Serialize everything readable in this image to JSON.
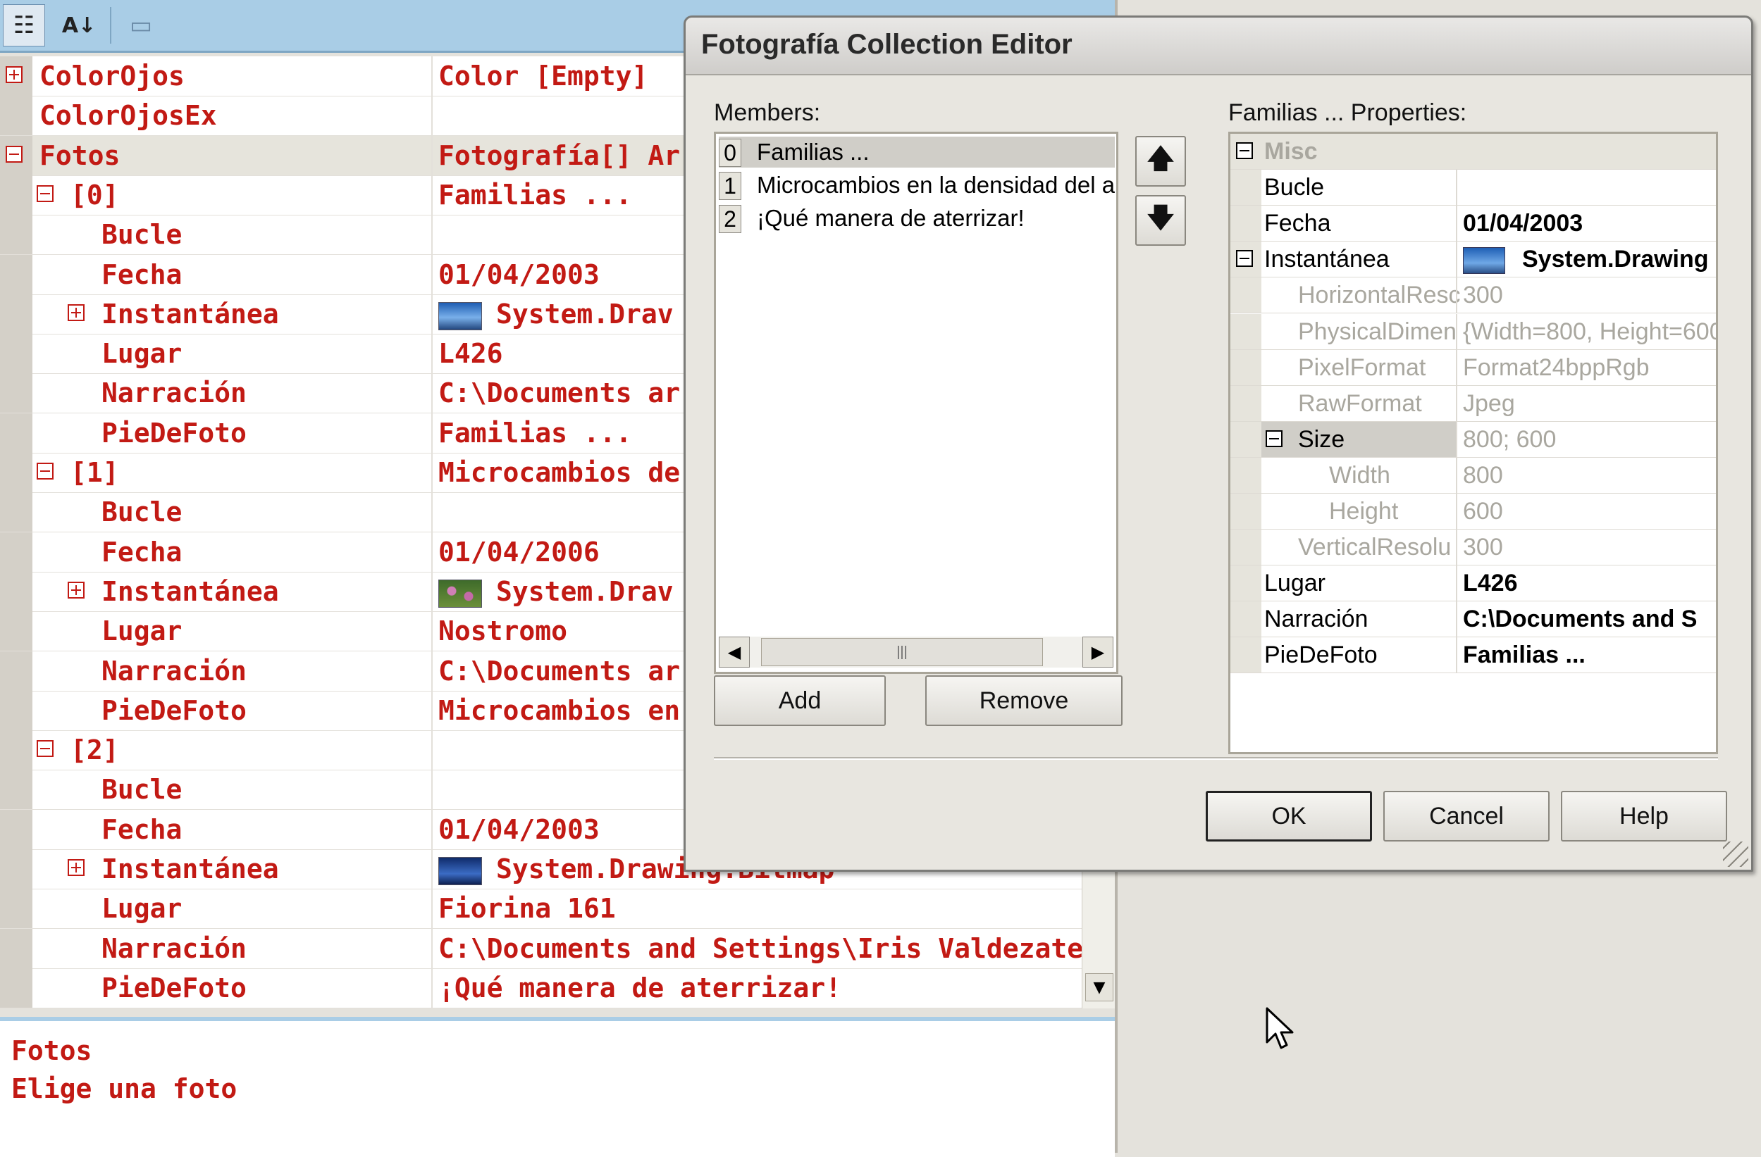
{
  "property_grid": {
    "toolbar": {
      "categorized_glyph": "☷",
      "alphabetical_glyph": "A↓",
      "property_pages_glyph": "▭"
    },
    "rows": [
      {
        "name": "ColorOjos",
        "value": "Color [Empty]",
        "level": 0,
        "toggle": "plus"
      },
      {
        "name": "ColorOjosEx",
        "value": "",
        "level": 0,
        "toggle": ""
      },
      {
        "name": "Fotos",
        "value": "Fotografía[] Arra",
        "level": 0,
        "toggle": "minus",
        "selected": true
      },
      {
        "name": "[0]",
        "value": "Familias ...",
        "level": 1,
        "toggle": "minus"
      },
      {
        "name": "Bucle",
        "value": "",
        "level": 2,
        "toggle": ""
      },
      {
        "name": "Fecha",
        "value": "01/04/2003",
        "level": 2,
        "toggle": ""
      },
      {
        "name": "Instantánea",
        "value": "System.Drav",
        "level": 2,
        "toggle": "plus",
        "thumb": "blue"
      },
      {
        "name": "Lugar",
        "value": "L426",
        "level": 2,
        "toggle": ""
      },
      {
        "name": "Narración",
        "value": "C:\\Documents ar",
        "level": 2,
        "toggle": ""
      },
      {
        "name": "PieDeFoto",
        "value": "Familias ...",
        "level": 2,
        "toggle": ""
      },
      {
        "name": "[1]",
        "value": "Microcambios de",
        "level": 1,
        "toggle": "minus"
      },
      {
        "name": "Bucle",
        "value": "",
        "level": 2,
        "toggle": ""
      },
      {
        "name": "Fecha",
        "value": "01/04/2006",
        "level": 2,
        "toggle": ""
      },
      {
        "name": "Instantánea",
        "value": "System.Drav",
        "level": 2,
        "toggle": "plus",
        "thumb": "flowers"
      },
      {
        "name": "Lugar",
        "value": "Nostromo",
        "level": 2,
        "toggle": ""
      },
      {
        "name": "Narración",
        "value": "C:\\Documents ar",
        "level": 2,
        "toggle": ""
      },
      {
        "name": "PieDeFoto",
        "value": "Microcambios en",
        "level": 2,
        "toggle": ""
      },
      {
        "name": "[2]",
        "value": "",
        "level": 1,
        "toggle": "minus"
      },
      {
        "name": "Bucle",
        "value": "",
        "level": 2,
        "toggle": ""
      },
      {
        "name": "Fecha",
        "value": "01/04/2003",
        "level": 2,
        "toggle": ""
      },
      {
        "name": "Instantánea",
        "value": "System.Drawing.Bitmap",
        "level": 2,
        "toggle": "plus",
        "thumb": "dark"
      },
      {
        "name": "Lugar",
        "value": "Fiorina 161",
        "level": 2,
        "toggle": ""
      },
      {
        "name": "Narración",
        "value": "C:\\Documents and Settings\\Iris Valdezate\\",
        "level": 2,
        "toggle": ""
      },
      {
        "name": "PieDeFoto",
        "value": "¡Qué manera de aterrizar!",
        "level": 2,
        "toggle": ""
      }
    ],
    "description": {
      "title": "Fotos",
      "text": "Elige una foto"
    },
    "scroll_down_glyph": "▼"
  },
  "dialog": {
    "title": "Fotografía Collection Editor",
    "members_label": "Members:",
    "members": [
      {
        "index": "0",
        "text": "Familias ...",
        "selected": true
      },
      {
        "index": "1",
        "text": "Microcambios en la densidad del a"
      },
      {
        "index": "2",
        "text": "¡Qué manera de aterrizar!"
      }
    ],
    "move_up_glyph": "🡅",
    "move_down_glyph": "🡇",
    "scroll_left_glyph": "◀",
    "scroll_right_glyph": "▶",
    "scroll_thumb_glyph": "|||",
    "add_label": "Add",
    "remove_label": "Remove",
    "properties_label": "Familias ... Properties:",
    "properties": [
      {
        "name": "Misc",
        "value": "",
        "indent": 0,
        "kind": "cat",
        "toggle": "minus"
      },
      {
        "name": "Bucle",
        "value": "",
        "indent": 0,
        "kind": "normal"
      },
      {
        "name": "Fecha",
        "value": "01/04/2003",
        "indent": 0,
        "kind": "normal"
      },
      {
        "name": "Instantánea",
        "value": "System.Drawing",
        "indent": 0,
        "kind": "normal",
        "toggle": "minus",
        "thumb": true
      },
      {
        "name": "HorizontalResc",
        "value": "300",
        "indent": 1,
        "kind": "gray"
      },
      {
        "name": "PhysicalDimen",
        "value": "{Width=800, Height=600",
        "indent": 1,
        "kind": "gray"
      },
      {
        "name": "PixelFormat",
        "value": "Format24bppRgb",
        "indent": 1,
        "kind": "gray"
      },
      {
        "name": "RawFormat",
        "value": "Jpeg",
        "indent": 1,
        "kind": "gray"
      },
      {
        "name": "Size",
        "value": "800; 600",
        "indent": 1,
        "kind": "size",
        "toggle": "minus"
      },
      {
        "name": "Width",
        "value": "800",
        "indent": 2,
        "kind": "gray"
      },
      {
        "name": "Height",
        "value": "600",
        "indent": 2,
        "kind": "gray"
      },
      {
        "name": "VerticalResolu",
        "value": "300",
        "indent": 1,
        "kind": "gray"
      },
      {
        "name": "Lugar",
        "value": "L426",
        "indent": 0,
        "kind": "normal"
      },
      {
        "name": "Narración",
        "value": "C:\\Documents and S",
        "indent": 0,
        "kind": "normal"
      },
      {
        "name": "PieDeFoto",
        "value": "Familias ...",
        "indent": 0,
        "kind": "normal"
      }
    ],
    "ok_label": "OK",
    "cancel_label": "Cancel",
    "help_label": "Help"
  }
}
